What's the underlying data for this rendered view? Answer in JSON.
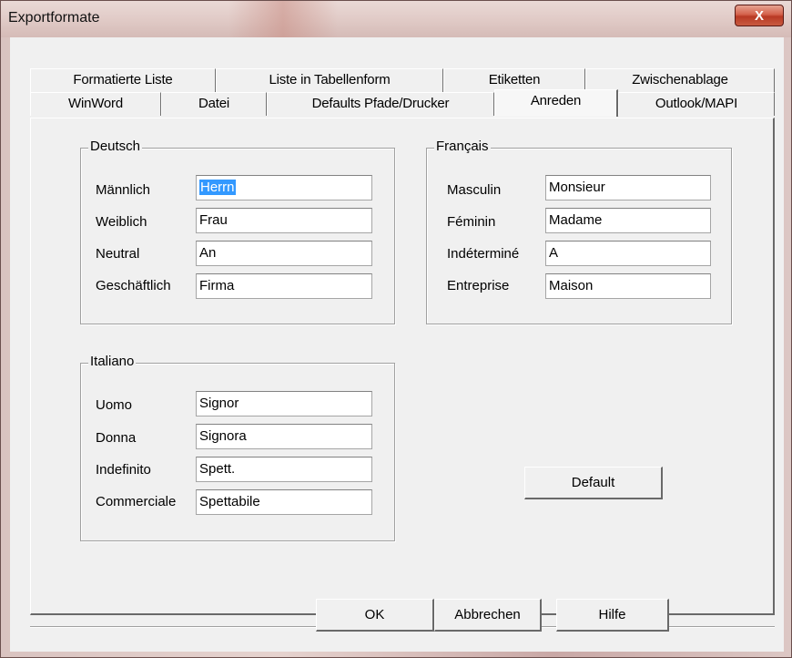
{
  "window": {
    "title": "Exportformate",
    "close_label": "X"
  },
  "tabs": {
    "back_row": [
      "Formatierte Liste",
      "Liste in Tabellenform",
      "Etiketten",
      "Zwischenablage"
    ],
    "front_row": [
      "WinWord",
      "Datei",
      "Defaults Pfade/Drucker",
      "Anreden",
      "Outlook/MAPI"
    ],
    "active": "Anreden"
  },
  "groups": {
    "deutsch": {
      "title": "Deutsch",
      "rows": [
        {
          "label": "Männlich",
          "value": "Herrn"
        },
        {
          "label": "Weiblich",
          "value": "Frau"
        },
        {
          "label": "Neutral",
          "value": "An"
        },
        {
          "label": "Geschäftlich",
          "value": "Firma"
        }
      ]
    },
    "francais": {
      "title": "Français",
      "rows": [
        {
          "label": "Masculin",
          "value": "Monsieur"
        },
        {
          "label": "Féminin",
          "value": "Madame"
        },
        {
          "label": "Indéterminé",
          "value": "A"
        },
        {
          "label": "Entreprise",
          "value": "Maison"
        }
      ]
    },
    "italiano": {
      "title": "Italiano",
      "rows": [
        {
          "label": "Uomo",
          "value": "Signor"
        },
        {
          "label": "Donna",
          "value": "Signora"
        },
        {
          "label": "Indefinito",
          "value": "Spett."
        },
        {
          "label": "Commerciale",
          "value": "Spettabile"
        }
      ]
    }
  },
  "buttons": {
    "default": "Default",
    "ok": "OK",
    "cancel": "Abbrechen",
    "help": "Hilfe"
  },
  "colors": {
    "selection": "#3399ff",
    "close_button": "#c85a40",
    "face": "#f0f0f0"
  }
}
